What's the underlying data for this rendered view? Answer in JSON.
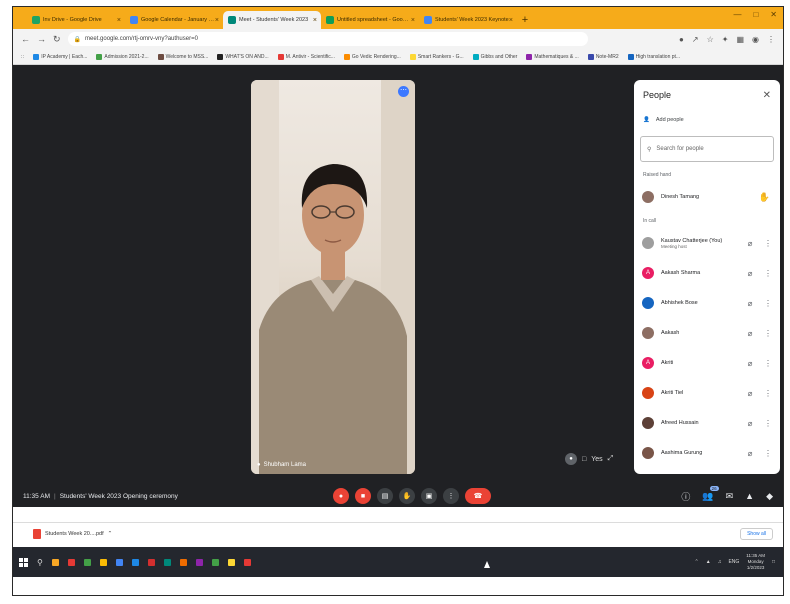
{
  "browser": {
    "tabs": [
      {
        "label": "Inv Drive - Google Drive",
        "color": "#1fa463",
        "active": false
      },
      {
        "label": "Google Calendar - January 2023",
        "color": "#4285f4",
        "active": false
      },
      {
        "label": "Meet - Students' Week 2023",
        "color": "#00897b",
        "active": true
      },
      {
        "label": "Untitled spreadsheet - Google S",
        "color": "#0f9d58",
        "active": false
      },
      {
        "label": "Students' Week 2023 Keynote",
        "color": "#4285f4",
        "active": false
      }
    ],
    "new_tab": "+",
    "url": "meet.google.com/rtj-omrv-vny?authuser=0",
    "bookmarks": [
      {
        "label": "IP Academy | Each...",
        "color": "#1e88e5"
      },
      {
        "label": "Admission 2021-2...",
        "color": "#43a047"
      },
      {
        "label": "Welcome to MSS...",
        "color": "#6d4c41"
      },
      {
        "label": "WHAT'S ON AND...",
        "color": "#212121"
      },
      {
        "label": "M. Antivir - Scientific...",
        "color": "#e53935"
      },
      {
        "label": "Go Vedic Rendering...",
        "color": "#fb8c00"
      },
      {
        "label": "Smart Rankers - G...",
        "color": "#fdd835"
      },
      {
        "label": "Gibbs and Other",
        "color": "#00acc1"
      },
      {
        "label": "Mathematiques & ...",
        "color": "#8e24aa"
      },
      {
        "label": "Note-MR2",
        "color": "#3949ab"
      },
      {
        "label": "High translation pt...",
        "color": "#1565c0"
      }
    ]
  },
  "video": {
    "participant_name": "Shubham Lama",
    "tile_colors": {
      "shirt": "#9a8a76",
      "skin": "#c89473",
      "hair": "#1d1714"
    },
    "bottom_label": "Yes"
  },
  "panel": {
    "title": "People",
    "add_people": "Add people",
    "search_placeholder": "Search for people",
    "raised_hand_section": "Raised hand",
    "in_call_section": "In call",
    "raised": [
      {
        "name": "Dinesh Tamang",
        "avatar_color": "#8d6e63",
        "initial": ""
      }
    ],
    "in_call": [
      {
        "name": "Kaustav Chatterjee (You)",
        "sub": "Meeting host",
        "avatar_color": "#9e9e9e",
        "initial": ""
      },
      {
        "name": "Aakash Sharma",
        "sub": "",
        "avatar_color": "#e91e63",
        "initial": "A"
      },
      {
        "name": "Abhishek Bose",
        "sub": "",
        "avatar_color": "#1565c0",
        "initial": ""
      },
      {
        "name": "Aakash",
        "sub": "",
        "avatar_color": "#8d6e63",
        "initial": ""
      },
      {
        "name": "Akriti",
        "sub": "",
        "avatar_color": "#e91e63",
        "initial": "A"
      },
      {
        "name": "Akriti Tiel",
        "sub": "",
        "avatar_color": "#d84315",
        "initial": ""
      },
      {
        "name": "Afreed Hussain",
        "sub": "",
        "avatar_color": "#5d4037",
        "initial": ""
      },
      {
        "name": "Aashima Gurung",
        "sub": "",
        "avatar_color": "#795548",
        "initial": ""
      }
    ]
  },
  "meeting": {
    "time": "11:35 AM",
    "title": "Students' Week 2023 Opening ceremony",
    "participant_count": "26"
  },
  "download": {
    "file": "Students Week 20....pdf",
    "show_all": "Show all"
  },
  "taskbar": {
    "lang": "ENG",
    "time": "11:35 AM",
    "day": "Monday",
    "date": "1/2/2023",
    "icon_colors": [
      "#f9a825",
      "#e53935",
      "#43a047",
      "#fbbc05",
      "#4285f4",
      "#1e88e5",
      "#d32f2f",
      "#00897b",
      "#ef6c00",
      "#8e24aa",
      "#43a047",
      "#fdd835",
      "#e53935"
    ]
  }
}
